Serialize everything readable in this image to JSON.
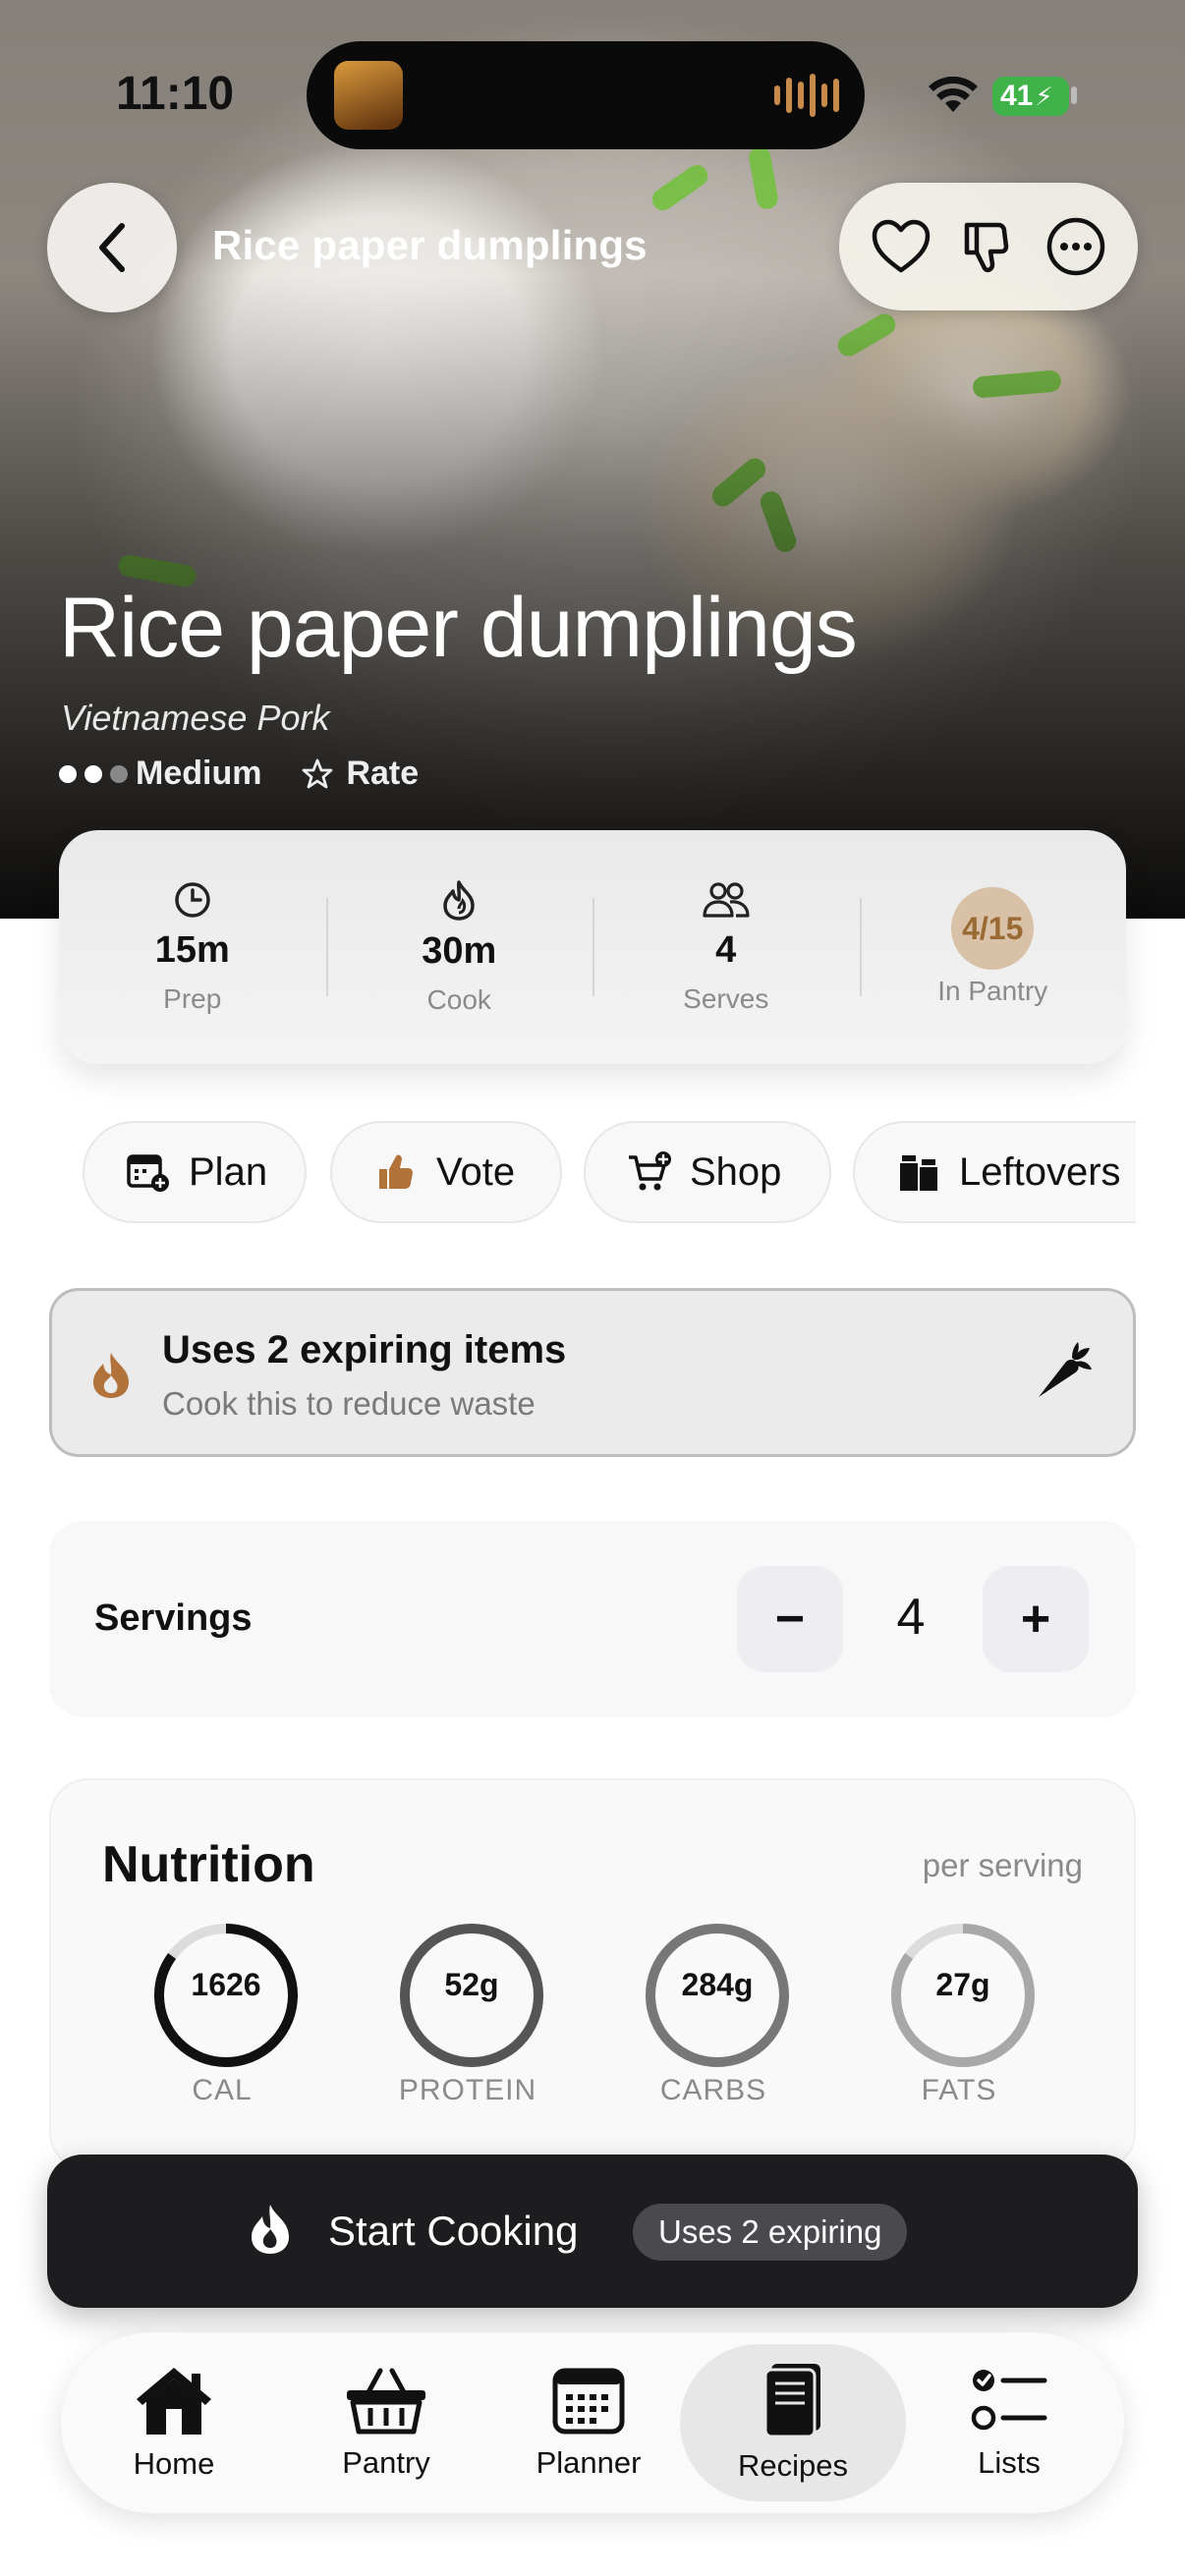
{
  "status_bar": {
    "time": "11:10",
    "battery": "41"
  },
  "nav": {
    "title": "Rice paper dumplings"
  },
  "hero": {
    "title": "Rice paper dumplings",
    "subtitle": "Vietnamese Pork",
    "difficulty": "Medium",
    "rate_label": "Rate",
    "difficulty_level": 2,
    "difficulty_max": 3
  },
  "stats": [
    {
      "icon": "clock-icon",
      "value": "15m",
      "label": "Prep"
    },
    {
      "icon": "flame-icon",
      "value": "30m",
      "label": "Cook"
    },
    {
      "icon": "people-icon",
      "value": "4",
      "label": "Serves"
    },
    {
      "icon": "pantry-badge",
      "value": "4/15",
      "label": "In Pantry"
    }
  ],
  "chips": [
    {
      "icon": "calendar-add-icon",
      "label": "Plan"
    },
    {
      "icon": "thumbs-up-icon",
      "label": "Vote"
    },
    {
      "icon": "cart-add-icon",
      "label": "Shop"
    },
    {
      "icon": "container-icon",
      "label": "Leftovers"
    }
  ],
  "expiring": {
    "title": "Uses 2 expiring items",
    "subtitle": "Cook this to reduce waste"
  },
  "servings": {
    "label": "Servings",
    "value": "4",
    "minus": "−",
    "plus": "+"
  },
  "nutrition": {
    "title": "Nutrition",
    "per": "per serving",
    "items": [
      {
        "value": "1626",
        "label": "CAL",
        "fraction": 0.85,
        "color": "#111111"
      },
      {
        "value": "52g",
        "label": "PROTEIN",
        "fraction": 1.0,
        "color": "#555555"
      },
      {
        "value": "284g",
        "label": "CARBS",
        "fraction": 1.0,
        "color": "#777777"
      },
      {
        "value": "27g",
        "label": "FATS",
        "fraction": 0.85,
        "color": "#a8a8a8"
      }
    ]
  },
  "cta": {
    "label": "Start Cooking",
    "badge": "Uses 2 expiring"
  },
  "tabs": [
    {
      "icon": "house-icon",
      "label": "Home",
      "active": false
    },
    {
      "icon": "basket-icon",
      "label": "Pantry",
      "active": false
    },
    {
      "icon": "calendar-icon",
      "label": "Planner",
      "active": false
    },
    {
      "icon": "book-icon",
      "label": "Recipes",
      "active": true
    },
    {
      "icon": "checklist-icon",
      "label": "Lists",
      "active": false
    }
  ],
  "colors": {
    "accent_brown": "#9a6a34",
    "cta_bg": "#1d1d20",
    "flame": "#b2733a"
  }
}
